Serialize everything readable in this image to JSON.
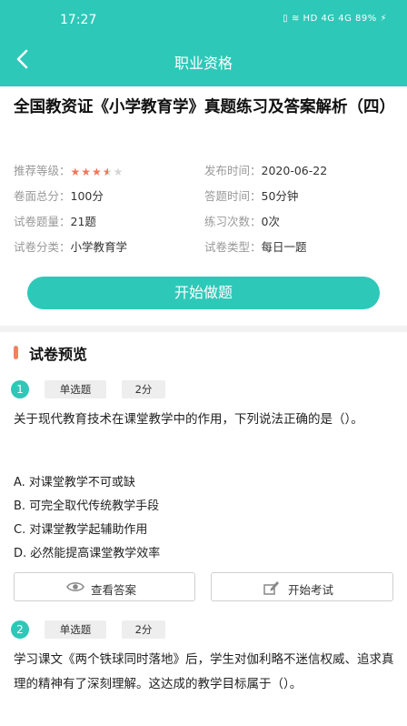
{
  "status_bar": {
    "time": "17:27",
    "indicators": "HD 4G 4G",
    "battery": "89%"
  },
  "nav": {
    "title": "职业资格"
  },
  "exam": {
    "title": "全国教资证《小学教育学》真题练习及答案解析（四）",
    "rating_label": "推荐等级：",
    "rating": 3.5,
    "rating_max": 5,
    "publish_label": "发布时间：",
    "publish_value": "2020-06-22",
    "score_label": "卷面总分：",
    "score_value": "100分",
    "time_label": "答题时间：",
    "time_value": "50分钟",
    "count_label": "试卷题量：",
    "count_value": "21题",
    "practice_label": "练习次数：",
    "practice_value": "0次",
    "category_label": "试卷分类：",
    "category_value": "小学教育学",
    "type_label": "试卷类型：",
    "type_value": "每日一题",
    "start_label": "开始做题"
  },
  "preview": {
    "section_title": "试卷预览",
    "questions": [
      {
        "num": "1",
        "type": "单选题",
        "points": "2分",
        "text": "关于现代教育技术在课堂教学中的作用，下列说法正确的是（）。",
        "options": [
          "A. 对课堂教学不可或缺",
          "B. 可完全取代传统教学手段",
          "C. 对课堂教学起辅助作用",
          "D. 必然能提高课堂教学效率"
        ]
      },
      {
        "num": "2",
        "type": "单选题",
        "points": "2分",
        "text": "学习课文《两个铁球同时落地》后，学生对伽利略不迷信权威、追求真理的精神有了深刻理解。这达成的教学目标属于（）。"
      }
    ],
    "view_answer_label": "查看答案",
    "start_exam_label": "开始考试"
  },
  "icons": {
    "back": "back-arrow-icon",
    "eye": "eye-icon",
    "exam": "exam-pen-icon",
    "star": "star-icon"
  },
  "colors": {
    "brand": "#2ec8b8",
    "accent": "#f28160",
    "star": "#f0775a"
  }
}
